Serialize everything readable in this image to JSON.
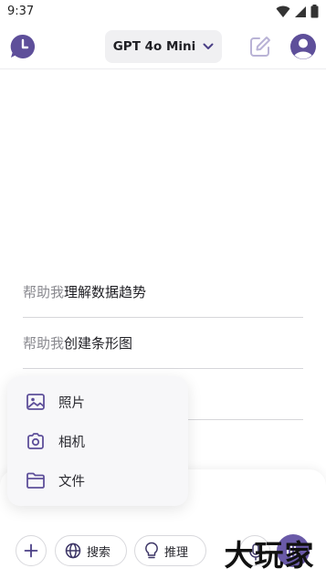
{
  "status_bar": {
    "time": "9:37"
  },
  "header": {
    "model_label": "GPT 4o Mini"
  },
  "suggestions": [
    {
      "prefix": "帮助我",
      "topic": "理解数据趋势"
    },
    {
      "prefix": "帮助我",
      "topic": "创建条形图"
    },
    {
      "prefix": "",
      "topic": ""
    },
    {
      "prefix": "",
      "topic": ""
    }
  ],
  "attach_menu": {
    "items": [
      {
        "label": "照片",
        "icon": "image-icon"
      },
      {
        "label": "相机",
        "icon": "camera-icon"
      },
      {
        "label": "文件",
        "icon": "folder-icon"
      }
    ]
  },
  "toolbar": {
    "search_label": "搜索",
    "reason_label": "推理"
  },
  "watermark": {
    "text": "大玩家"
  },
  "colors": {
    "accent": "#6a5aa8",
    "icon_purple": "#5e4f9a",
    "icon_muted": "#b9b3d6"
  }
}
